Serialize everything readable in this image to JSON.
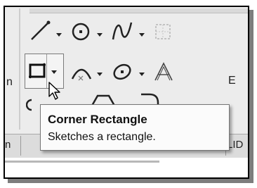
{
  "ribbon": {
    "left_group_label": "n",
    "right_group_label": "E",
    "tools": [
      {
        "name": "line-icon"
      },
      {
        "name": "center-circle-icon"
      },
      {
        "name": "spline-icon"
      },
      {
        "name": "point-grid-icon"
      },
      {
        "name": "corner-rectangle-icon"
      },
      {
        "name": "arc-icon"
      },
      {
        "name": "ellipse-icon"
      },
      {
        "name": "text-icon"
      }
    ]
  },
  "tooltip": {
    "title": "Corner Rectangle",
    "description": "Sketches a rectangle."
  },
  "tabs": {
    "left": "n",
    "right": "LID"
  },
  "colors": {
    "ribbon_bg": "#ececec",
    "tooltip_bg": "#fbfbfb",
    "shadow": "#7d7d7d"
  }
}
